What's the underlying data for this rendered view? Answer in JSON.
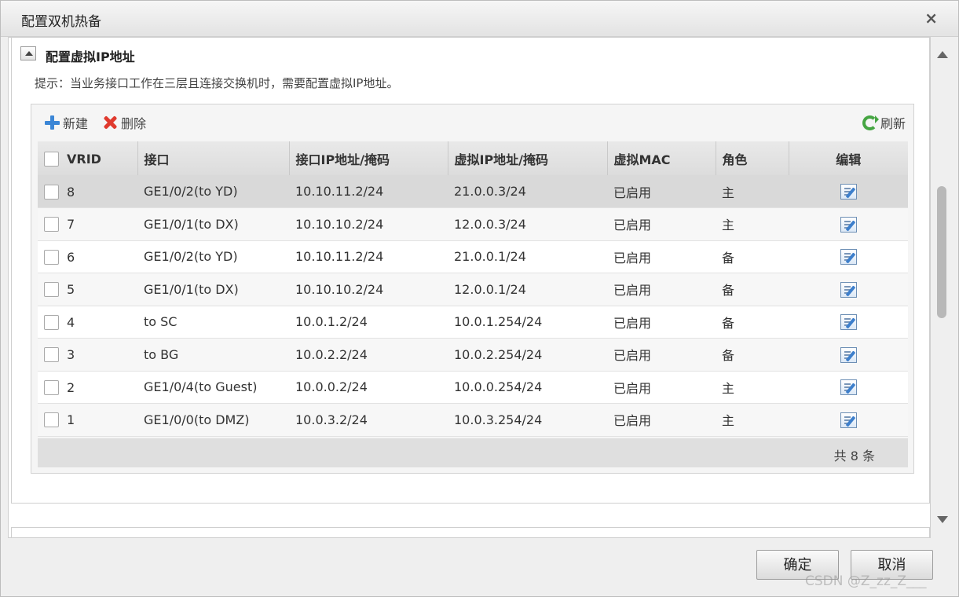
{
  "dialog": {
    "title": "配置双机热备",
    "close_glyph": "×"
  },
  "section": {
    "title": "配置虚拟IP地址",
    "hint": "提示：当业务接口工作在三层且连接交换机时，需要配置虚拟IP地址。"
  },
  "toolbar": {
    "new_label": "新建",
    "delete_label": "删除",
    "refresh_label": "刷新"
  },
  "table": {
    "headers": {
      "vrid": "VRID",
      "interface": "接口",
      "ip": "接口IP地址/掩码",
      "vip": "虚拟IP地址/掩码",
      "vmac": "虚拟MAC",
      "role": "角色",
      "edit": "编辑"
    },
    "rows": [
      {
        "vrid": "8",
        "interface": "GE1/0/2(to YD)",
        "ip": "10.10.11.2/24",
        "vip": "21.0.0.3/24",
        "vmac": "已启用",
        "role": "主"
      },
      {
        "vrid": "7",
        "interface": "GE1/0/1(to DX)",
        "ip": "10.10.10.2/24",
        "vip": "12.0.0.3/24",
        "vmac": "已启用",
        "role": "主"
      },
      {
        "vrid": "6",
        "interface": "GE1/0/2(to YD)",
        "ip": "10.10.11.2/24",
        "vip": "21.0.0.1/24",
        "vmac": "已启用",
        "role": "备"
      },
      {
        "vrid": "5",
        "interface": "GE1/0/1(to DX)",
        "ip": "10.10.10.2/24",
        "vip": "12.0.0.1/24",
        "vmac": "已启用",
        "role": "备"
      },
      {
        "vrid": "4",
        "interface": "to SC",
        "ip": "10.0.1.2/24",
        "vip": "10.0.1.254/24",
        "vmac": "已启用",
        "role": "备"
      },
      {
        "vrid": "3",
        "interface": "to BG",
        "ip": "10.0.2.2/24",
        "vip": "10.0.2.254/24",
        "vmac": "已启用",
        "role": "备"
      },
      {
        "vrid": "2",
        "interface": "GE1/0/4(to Guest)",
        "ip": "10.0.0.2/24",
        "vip": "10.0.0.254/24",
        "vmac": "已启用",
        "role": "主"
      },
      {
        "vrid": "1",
        "interface": "GE1/0/0(to DMZ)",
        "ip": "10.0.3.2/24",
        "vip": "10.0.3.254/24",
        "vmac": "已启用",
        "role": "主"
      }
    ],
    "selected_row_index": 0,
    "total": "共 8 条"
  },
  "buttons": {
    "ok": "确定",
    "cancel": "取消"
  },
  "watermark": "CSDN @Z_zz_Z___",
  "colors": {
    "selected_row": "#d9d9d9",
    "add_icon": "#3b86d6",
    "delete_icon": "#e03a2e",
    "refresh_icon": "#45a542"
  }
}
